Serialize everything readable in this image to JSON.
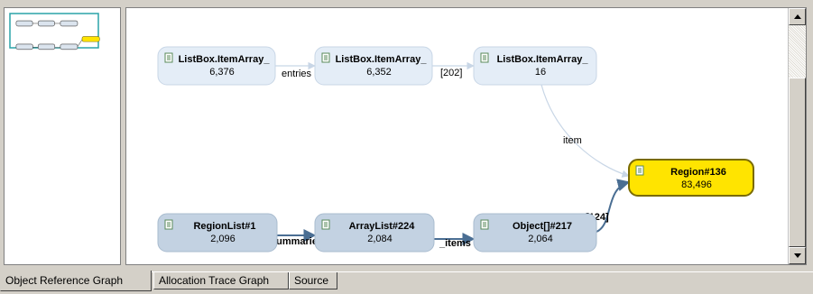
{
  "graph": {
    "nodes": [
      {
        "id": "n1",
        "title": "ListBox.ItemArray_",
        "value": "6,376",
        "style": "light"
      },
      {
        "id": "n2",
        "title": "ListBox.ItemArray_",
        "value": "6,352",
        "style": "light"
      },
      {
        "id": "n3",
        "title": "ListBox.ItemArray_",
        "value": "16",
        "style": "light"
      },
      {
        "id": "n4",
        "title": "Region#136",
        "value": "83,496",
        "style": "highlight"
      },
      {
        "id": "n5",
        "title": "RegionList#1",
        "value": "2,096",
        "style": "medium"
      },
      {
        "id": "n6",
        "title": "ArrayList#224",
        "value": "2,084",
        "style": "medium"
      },
      {
        "id": "n7",
        "title": "Object[]#217",
        "value": "2,064",
        "style": "medium"
      }
    ],
    "edges": [
      {
        "from": "n1",
        "to": "n2",
        "label": "entries",
        "style": "light"
      },
      {
        "from": "n2",
        "to": "n3",
        "label": "[202]",
        "style": "light"
      },
      {
        "from": "n3",
        "to": "n4",
        "label": "item",
        "style": "light"
      },
      {
        "from": "n5",
        "to": "n6",
        "label": "summaries",
        "style": "dark"
      },
      {
        "from": "n6",
        "to": "n7",
        "label": "_items",
        "style": "dark"
      },
      {
        "from": "n7",
        "to": "n4",
        "label": "[124]",
        "style": "dark"
      }
    ]
  },
  "tabs": [
    {
      "label": "Object Reference Graph",
      "active": true
    },
    {
      "label": "Allocation Trace Graph",
      "active": false
    },
    {
      "label": "Source",
      "active": false
    }
  ],
  "colors": {
    "light_node_fill": "#e4edf7",
    "light_node_border": "#c8d6e6",
    "medium_node_fill": "#c3d2e2",
    "medium_node_border": "#a9bccf",
    "highlight_fill": "#ffe400",
    "highlight_border": "#7a6b00",
    "light_edge": "#c8d6e6",
    "dark_edge": "#4a6e93",
    "minimap_border": "#2aa3a8"
  },
  "icons": {
    "node_icon": "document-icon",
    "scroll_up": "arrow-up-icon",
    "scroll_down": "arrow-down-icon"
  }
}
